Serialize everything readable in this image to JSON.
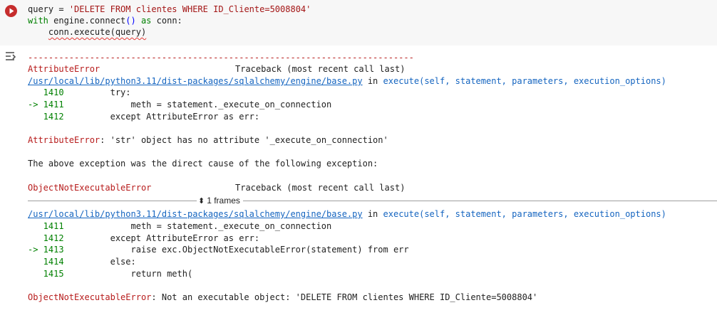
{
  "cell": {
    "code_lines": {
      "l1_var": "query",
      "l1_eq": " = ",
      "l1_str": "'DELETE FROM clientes WHERE ID_Cliente=5008804'",
      "l2_with": "with",
      "l2_mid": " engine.connect",
      "l2_paren": "()",
      "l2_as": " as",
      "l2_end": " conn:",
      "l3_indent": "    ",
      "l3_text": "conn.execute(query)"
    }
  },
  "output": {
    "separator": "---------------------------------------------------------------------------",
    "err1_name": "AttributeError",
    "err1_traceback": "Traceback (most recent call last)",
    "file_path": "/usr/local/lib/python3.11/dist-packages/sqlalchemy/engine/base.py",
    "in_word": " in ",
    "func_sig": "execute(self, statement, parameters, execution_options)",
    "frame1": [
      {
        "prefix": "   1410 ",
        "code": "        try:"
      },
      {
        "prefix": "-> 1411 ",
        "code": "            meth = statement._execute_on_connection"
      },
      {
        "prefix": "   1412 ",
        "code": "        except AttributeError as err:"
      }
    ],
    "err1_msg_name": "AttributeError",
    "err1_msg": ": 'str' object has no attribute '_execute_on_connection'",
    "cause_text": "The above exception was the direct cause of the following exception:",
    "err2_name": "ObjectNotExecutableError",
    "err2_traceback": "Traceback (most recent call last)",
    "frames_label": "1 frames",
    "frame2": [
      {
        "prefix": "   1411 ",
        "code": "            meth = statement._execute_on_connection"
      },
      {
        "prefix": "   1412 ",
        "code": "        except AttributeError as err:"
      },
      {
        "prefix": "-> 1413 ",
        "code": "            raise exc.ObjectNotExecutableError(statement) from err"
      },
      {
        "prefix": "   1414 ",
        "code": "        else:"
      },
      {
        "prefix": "   1415 ",
        "code": "            return meth("
      }
    ],
    "err2_msg_name": "ObjectNotExecutableError",
    "err2_msg": ": Not an executable object: 'DELETE FROM clientes WHERE ID_Cliente=5008804'"
  },
  "icons": {
    "run": "play-circle-icon",
    "output": "output-settings-icon",
    "frames": "chevron-updown-icon"
  },
  "colors": {
    "error": "#b71c1c",
    "link": "#1565c0",
    "run_button": "#c62d2d"
  }
}
